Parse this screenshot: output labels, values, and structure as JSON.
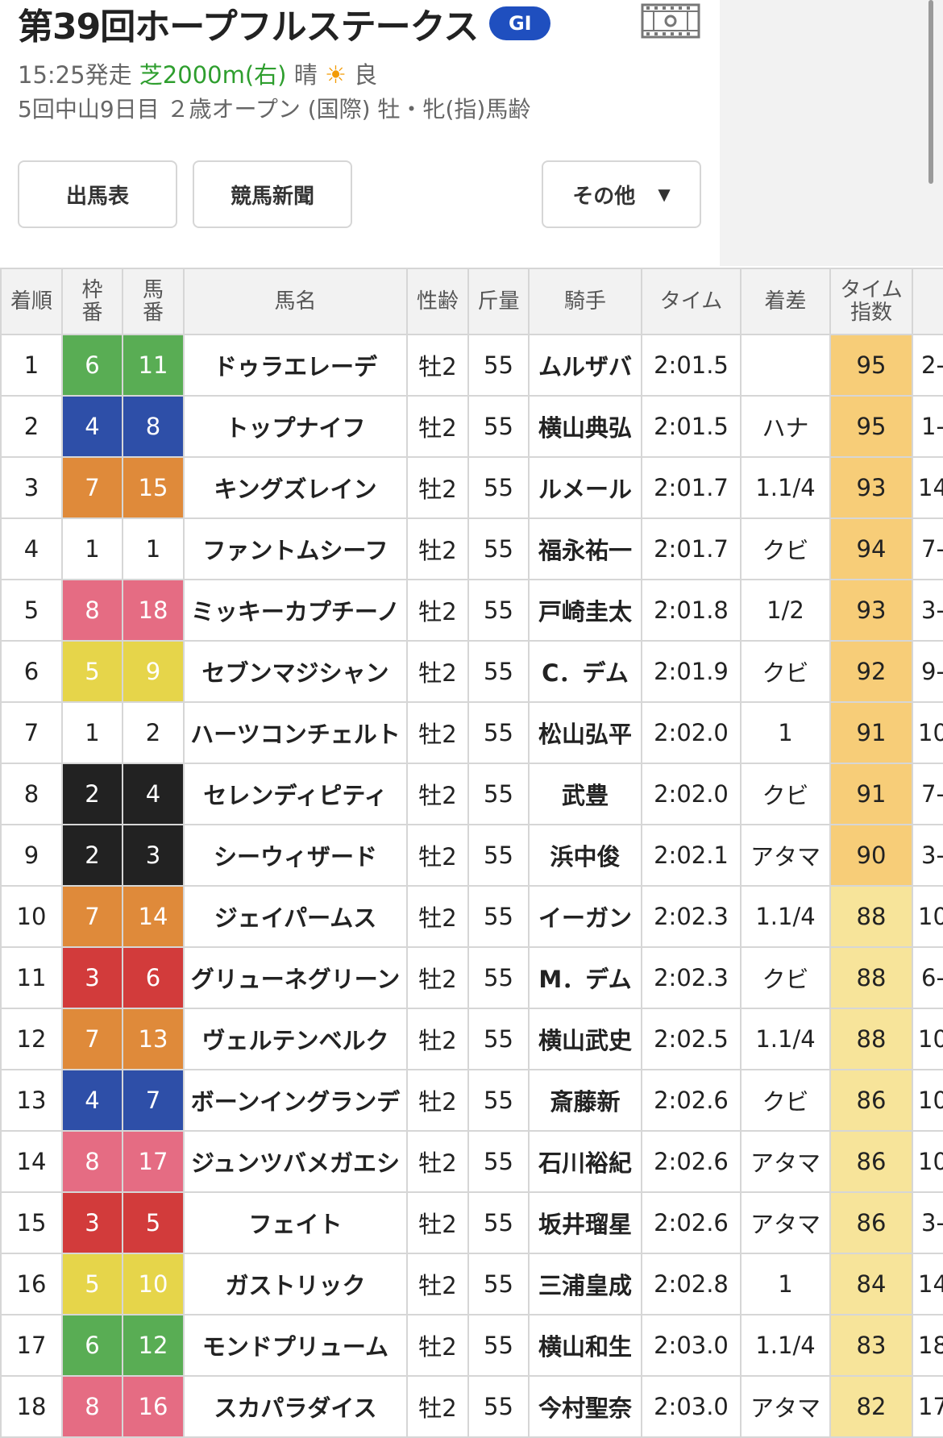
{
  "race": {
    "title": "第39回ホープフルステークス",
    "grade": "GI",
    "start_time": "15:25発走",
    "course": "芝2000m(右)",
    "weather": "晴",
    "weather_icon": "sun-icon",
    "going": "良",
    "details": "5回中山9日目 ２歳オープン (国際) 牡・牝(指)馬齢"
  },
  "buttons": {
    "entry": "出馬表",
    "newspaper": "競馬新聞",
    "other": "その他",
    "other_caret": "▼"
  },
  "table": {
    "headers": {
      "rank": "着順",
      "waku_1": "枠",
      "waku_2": "番",
      "uma_1": "馬",
      "uma_2": "番",
      "horse": "馬名",
      "sex": "性齢",
      "weight": "斤量",
      "jockey": "騎手",
      "time": "タイム",
      "margin": "着差",
      "index_1": "タイム",
      "index_2": "指数"
    },
    "waku_colors": {
      "1": {
        "bg": "#ffffff",
        "fg": "#222222"
      },
      "2": {
        "bg": "#222222",
        "fg": "#ffffff"
      },
      "3": {
        "bg": "#d23b3b",
        "fg": "#ffffff"
      },
      "4": {
        "bg": "#2e4fa8",
        "fg": "#ffffff"
      },
      "5": {
        "bg": "#e6d54a",
        "fg": "#ffffff"
      },
      "6": {
        "bg": "#59ad54",
        "fg": "#ffffff"
      },
      "7": {
        "bg": "#df8a3a",
        "fg": "#ffffff"
      },
      "8": {
        "bg": "#e56c83",
        "fg": "#ffffff"
      }
    },
    "rows": [
      {
        "rank": "1",
        "waku": "6",
        "uma": "11",
        "horse": "ドゥラエレーデ",
        "sex": "牡2",
        "weight": "55",
        "jockey": "ムルザバ",
        "time": "2:01.5",
        "margin": "",
        "index": "95",
        "extra": "2-"
      },
      {
        "rank": "2",
        "waku": "4",
        "uma": "8",
        "horse": "トップナイフ",
        "sex": "牡2",
        "weight": "55",
        "jockey": "横山典弘",
        "time": "2:01.5",
        "margin": "ハナ",
        "index": "95",
        "extra": "1-"
      },
      {
        "rank": "3",
        "waku": "7",
        "uma": "15",
        "horse": "キングズレイン",
        "sex": "牡2",
        "weight": "55",
        "jockey": "ルメール",
        "time": "2:01.7",
        "margin": "1.1/4",
        "index": "93",
        "extra": "14"
      },
      {
        "rank": "4",
        "waku": "1",
        "uma": "1",
        "horse": "ファントムシーフ",
        "sex": "牡2",
        "weight": "55",
        "jockey": "福永祐一",
        "time": "2:01.7",
        "margin": "クビ",
        "index": "94",
        "extra": "7-"
      },
      {
        "rank": "5",
        "waku": "8",
        "uma": "18",
        "horse": "ミッキーカプチーノ",
        "sex": "牡2",
        "weight": "55",
        "jockey": "戸崎圭太",
        "time": "2:01.8",
        "margin": "1/2",
        "index": "93",
        "extra": "3-"
      },
      {
        "rank": "6",
        "waku": "5",
        "uma": "9",
        "horse": "セブンマジシャン",
        "sex": "牡2",
        "weight": "55",
        "jockey": "C．デム",
        "time": "2:01.9",
        "margin": "クビ",
        "index": "92",
        "extra": "9-"
      },
      {
        "rank": "7",
        "waku": "1",
        "uma": "2",
        "horse": "ハーツコンチェルト",
        "sex": "牡2",
        "weight": "55",
        "jockey": "松山弘平",
        "time": "2:02.0",
        "margin": "1",
        "index": "91",
        "extra": "10"
      },
      {
        "rank": "8",
        "waku": "2",
        "uma": "4",
        "horse": "セレンディピティ",
        "sex": "牡2",
        "weight": "55",
        "jockey": "武豊",
        "time": "2:02.0",
        "margin": "クビ",
        "index": "91",
        "extra": "7-"
      },
      {
        "rank": "9",
        "waku": "2",
        "uma": "3",
        "horse": "シーウィザード",
        "sex": "牡2",
        "weight": "55",
        "jockey": "浜中俊",
        "time": "2:02.1",
        "margin": "アタマ",
        "index": "90",
        "extra": "3-"
      },
      {
        "rank": "10",
        "waku": "7",
        "uma": "14",
        "horse": "ジェイパームス",
        "sex": "牡2",
        "weight": "55",
        "jockey": "イーガン",
        "time": "2:02.3",
        "margin": "1.1/4",
        "index": "88",
        "extra": "10"
      },
      {
        "rank": "11",
        "waku": "3",
        "uma": "6",
        "horse": "グリューネグリーン",
        "sex": "牡2",
        "weight": "55",
        "jockey": "M．デム",
        "time": "2:02.3",
        "margin": "クビ",
        "index": "88",
        "extra": "6-"
      },
      {
        "rank": "12",
        "waku": "7",
        "uma": "13",
        "horse": "ヴェルテンベルク",
        "sex": "牡2",
        "weight": "55",
        "jockey": "横山武史",
        "time": "2:02.5",
        "margin": "1.1/4",
        "index": "88",
        "extra": "10"
      },
      {
        "rank": "13",
        "waku": "4",
        "uma": "7",
        "horse": "ボーンイングランデ",
        "sex": "牡2",
        "weight": "55",
        "jockey": "斎藤新",
        "time": "2:02.6",
        "margin": "クビ",
        "index": "86",
        "extra": "10"
      },
      {
        "rank": "14",
        "waku": "8",
        "uma": "17",
        "horse": "ジュンツバメガエシ",
        "sex": "牡2",
        "weight": "55",
        "jockey": "石川裕紀",
        "time": "2:02.6",
        "margin": "アタマ",
        "index": "86",
        "extra": "10"
      },
      {
        "rank": "15",
        "waku": "3",
        "uma": "5",
        "horse": "フェイト",
        "sex": "牡2",
        "weight": "55",
        "jockey": "坂井瑠星",
        "time": "2:02.6",
        "margin": "アタマ",
        "index": "86",
        "extra": "3-"
      },
      {
        "rank": "16",
        "waku": "5",
        "uma": "10",
        "horse": "ガストリック",
        "sex": "牡2",
        "weight": "55",
        "jockey": "三浦皇成",
        "time": "2:02.8",
        "margin": "1",
        "index": "84",
        "extra": "14"
      },
      {
        "rank": "17",
        "waku": "6",
        "uma": "12",
        "horse": "モンドプリューム",
        "sex": "牡2",
        "weight": "55",
        "jockey": "横山和生",
        "time": "2:03.0",
        "margin": "1.1/4",
        "index": "83",
        "extra": "18"
      },
      {
        "rank": "18",
        "waku": "8",
        "uma": "16",
        "horse": "スカパラダイス",
        "sex": "牡2",
        "weight": "55",
        "jockey": "今村聖奈",
        "time": "2:03.0",
        "margin": "アタマ",
        "index": "82",
        "extra": "17"
      }
    ]
  }
}
